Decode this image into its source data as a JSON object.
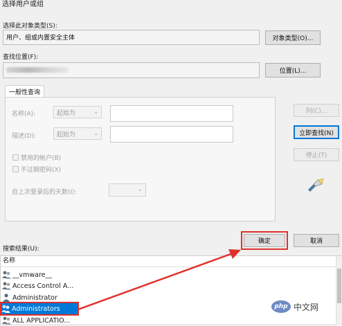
{
  "window": {
    "title": "选择用户或组"
  },
  "object_type": {
    "label": "选择此对象类型(S):",
    "value": "用户、组或内置安全主体",
    "button": "对象类型(O)..."
  },
  "location": {
    "label": "查找位置(F):",
    "button": "位置(L)..."
  },
  "query": {
    "tab": "一般性查询",
    "name_label": "名称(A):",
    "name_mode": "起始为",
    "desc_label": "描述(D):",
    "desc_mode": "起始为",
    "disabled_accounts": "禁用的帐户(B)",
    "non_expiring_passwords": "不过期密码(X)",
    "days_since_logon": "自上次登录后的天数(I):"
  },
  "side_buttons": {
    "columns": "列(C)...",
    "find_now": "立即查找(N)",
    "stop": "停止(T)"
  },
  "footer": {
    "ok": "确定",
    "cancel": "取消"
  },
  "results": {
    "label": "搜索结果(U):",
    "column_name": "名称",
    "items": [
      "__vmware__",
      "Access Control A...",
      "Administrator",
      "Administrators",
      "ALL APPLICATIO..."
    ]
  },
  "watermark": {
    "text": "中文网",
    "logo_text": "php"
  },
  "colors": {
    "highlight": "#e0302a",
    "accent": "#0078d7"
  }
}
